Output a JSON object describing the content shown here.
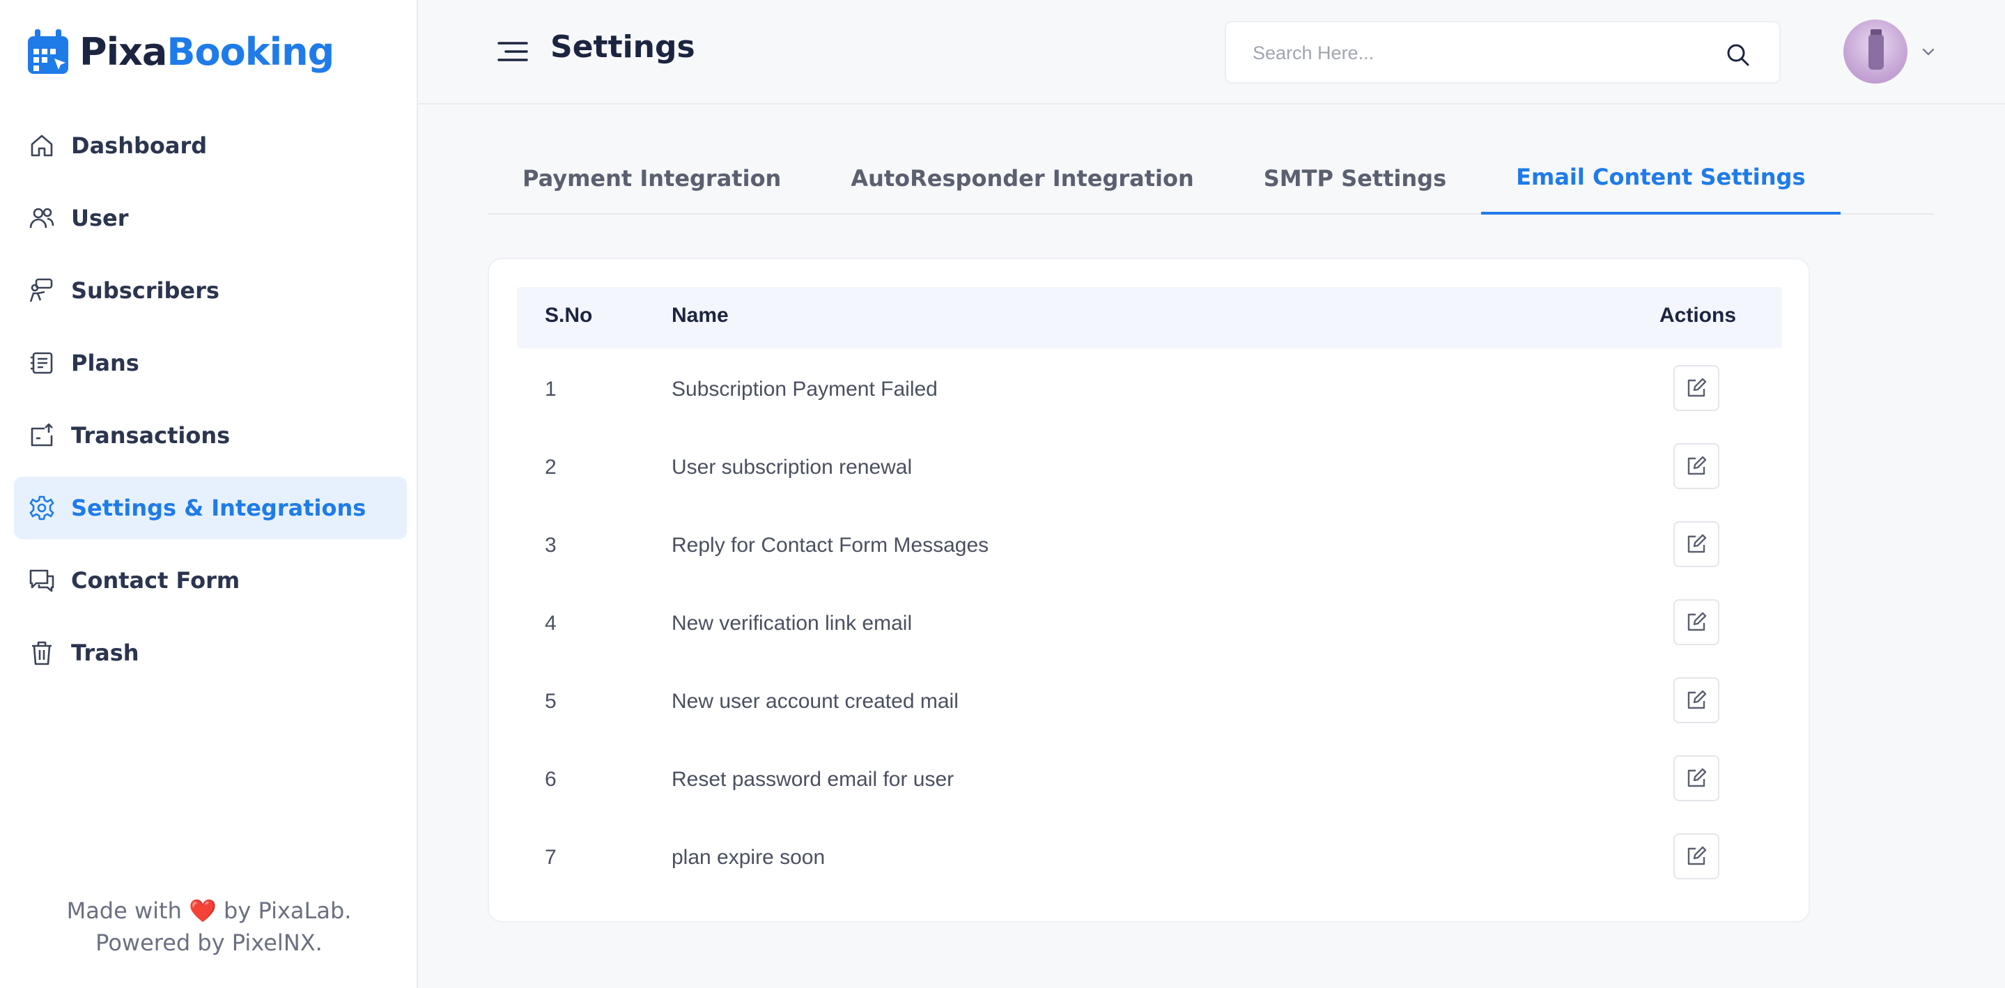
{
  "brand": {
    "part1": "Pixa",
    "part2": "Booking",
    "accent": "#1f7be8"
  },
  "sidebar": {
    "items": [
      {
        "label": "Dashboard",
        "icon": "home-icon"
      },
      {
        "label": "User",
        "icon": "users-icon"
      },
      {
        "label": "Subscribers",
        "icon": "subscribers-icon"
      },
      {
        "label": "Plans",
        "icon": "plans-icon"
      },
      {
        "label": "Transactions",
        "icon": "transactions-icon"
      },
      {
        "label": "Settings & Integrations",
        "icon": "gear-icon",
        "active": true
      },
      {
        "label": "Contact Form",
        "icon": "chat-icon"
      },
      {
        "label": "Trash",
        "icon": "trash-icon"
      }
    ],
    "footer": {
      "made_with": "Made with",
      "heart": "❤️",
      "by": "by PixaLab.",
      "powered": "Powered by PixelNX."
    }
  },
  "header": {
    "title": "Settings",
    "search_placeholder": "Search Here...",
    "avatar": "user-avatar"
  },
  "tabs": [
    {
      "label": "Payment Integration",
      "active": false
    },
    {
      "label": "AutoResponder Integration",
      "active": false
    },
    {
      "label": "SMTP Settings",
      "active": false
    },
    {
      "label": "Email Content Settings",
      "active": true
    }
  ],
  "table": {
    "columns": {
      "sno": "S.No",
      "name": "Name",
      "actions": "Actions"
    },
    "rows": [
      {
        "sno": "1",
        "name": "Subscription Payment Failed"
      },
      {
        "sno": "2",
        "name": "User subscription renewal"
      },
      {
        "sno": "3",
        "name": "Reply for Contact Form Messages"
      },
      {
        "sno": "4",
        "name": "New verification link email"
      },
      {
        "sno": "5",
        "name": "New user account created mail"
      },
      {
        "sno": "6",
        "name": "Reset password email for user"
      },
      {
        "sno": "7",
        "name": "plan expire soon"
      }
    ],
    "row_action_icon": "edit-icon"
  }
}
